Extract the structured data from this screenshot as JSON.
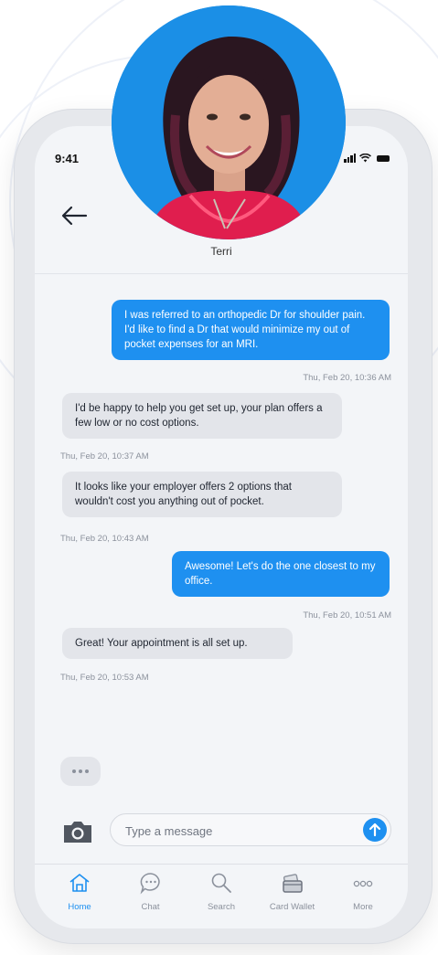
{
  "status_bar": {
    "time": "9:41"
  },
  "header": {
    "contact_name": "Terri"
  },
  "messages": [
    {
      "direction": "out",
      "text": "I was referred to an orthopedic Dr for shoulder pain. I'd like to find a Dr that would minimize my out of pocket expenses for an MRI.",
      "timestamp": "Thu, Feb 20, 10:36 AM"
    },
    {
      "direction": "in",
      "text": "I'd be happy to help you get set up, your plan offers a few low or no cost options.",
      "timestamp": "Thu, Feb 20, 10:37 AM"
    },
    {
      "direction": "in",
      "text": "It looks like your employer offers 2 options that wouldn't cost you anything out of pocket.",
      "timestamp": "Thu, Feb 20, 10:43 AM"
    },
    {
      "direction": "out",
      "text": "Awesome! Let's do the one closest to my office.",
      "timestamp": "Thu, Feb 20, 10:51 AM"
    },
    {
      "direction": "in",
      "text": "Great! Your appointment is all set up.",
      "timestamp": "Thu, Feb 20, 10:53 AM"
    }
  ],
  "composer": {
    "placeholder": "Type a message"
  },
  "bottom_nav": {
    "items": [
      {
        "label": "Home",
        "icon": "home-icon",
        "active": true
      },
      {
        "label": "Chat",
        "icon": "chat-icon",
        "active": false
      },
      {
        "label": "Search",
        "icon": "search-icon",
        "active": false
      },
      {
        "label": "Card Wallet",
        "icon": "card-wallet-icon",
        "active": false
      },
      {
        "label": "More",
        "icon": "more-icon",
        "active": false
      }
    ]
  },
  "colors": {
    "accent": "#1e90f0",
    "incoming_bubble": "#e3e5ea",
    "avatar_background": "#1b8fe6"
  }
}
